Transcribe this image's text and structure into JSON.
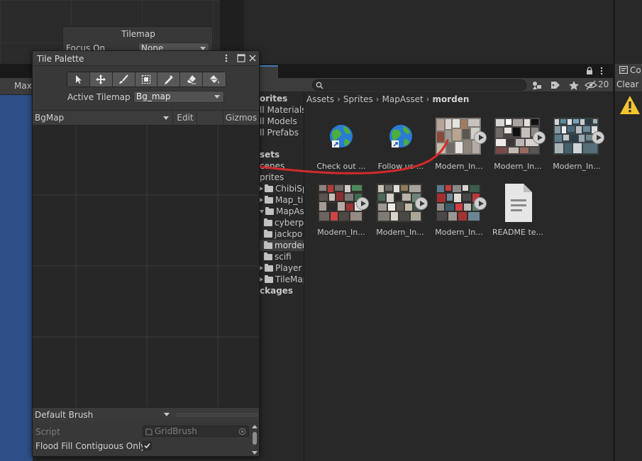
{
  "tilemap_inspector": {
    "title": "Tilemap",
    "focus_label": "Focus On",
    "focus_value": "None"
  },
  "scene_view": {
    "toolbar_label": "Max"
  },
  "project": {
    "tab_label": "ct",
    "search_placeholder": "",
    "hidden_count": "20",
    "breadcrumb": [
      "Assets",
      "Sprites",
      "MapAsset",
      "morden"
    ],
    "tree": [
      {
        "label": "orites",
        "style": "bold"
      },
      {
        "label": "ll Materials",
        "style": "normal"
      },
      {
        "label": "ll Models",
        "style": "normal"
      },
      {
        "label": "ll Prefabs",
        "style": "normal"
      },
      {
        "label": "sets",
        "style": "bold"
      },
      {
        "label": "cenes",
        "style": "normal"
      },
      {
        "label": "prites",
        "style": "normal"
      },
      {
        "label": "ChibiSpri",
        "style": "normal"
      },
      {
        "label": "Map_tiles",
        "style": "normal"
      },
      {
        "label": "MapAsse",
        "style": "normal"
      },
      {
        "label": "cyberp",
        "style": "normal"
      },
      {
        "label": "jackpo",
        "style": "normal"
      },
      {
        "label": "morden",
        "style": "selected"
      },
      {
        "label": "scifi",
        "style": "normal"
      },
      {
        "label": "Player",
        "style": "normal"
      },
      {
        "label": "TileMap",
        "style": "normal"
      },
      {
        "label": "ckages",
        "style": "bold"
      }
    ],
    "assets": [
      {
        "label": "Check out ...",
        "kind": "web-link"
      },
      {
        "label": "Follow us ...",
        "kind": "web-link"
      },
      {
        "label": "Modern_In...",
        "kind": "spritesheet"
      },
      {
        "label": "Modern_In...",
        "kind": "spritesheet"
      },
      {
        "label": "Modern_In...",
        "kind": "spritesheet"
      },
      {
        "label": "Modern_In...",
        "kind": "spritesheet"
      },
      {
        "label": "Modern_In...",
        "kind": "spritesheet"
      },
      {
        "label": "Modern_In...",
        "kind": "spritesheet"
      },
      {
        "label": "README te...",
        "kind": "text-document"
      }
    ]
  },
  "console": {
    "title": "Co",
    "clear_label": "Clear"
  },
  "tile_palette": {
    "title": "Tile Palette",
    "tools": [
      "select-tool",
      "move-tool",
      "paint-brush-tool",
      "box-fill-tool",
      "picker-tool",
      "eraser-tool",
      "fill-tool"
    ],
    "active_tilemap_label": "Active Tilemap",
    "active_tilemap_value": "Bg_map",
    "palette_name": "BgMap",
    "edit_label": "Edit",
    "gizmos_label": "Gizmos",
    "brush_name": "Default Brush",
    "script_label": "Script",
    "script_value": "GridBrush",
    "flood_fill_label": "Flood Fill Contiguous Only",
    "flood_fill_checked": true
  },
  "colors": {
    "scene_blue": "#2f4f88",
    "annotation_red": "#d42a2a",
    "warning_yellow": "#f4c430",
    "tab_accent": "#3a79bb"
  }
}
